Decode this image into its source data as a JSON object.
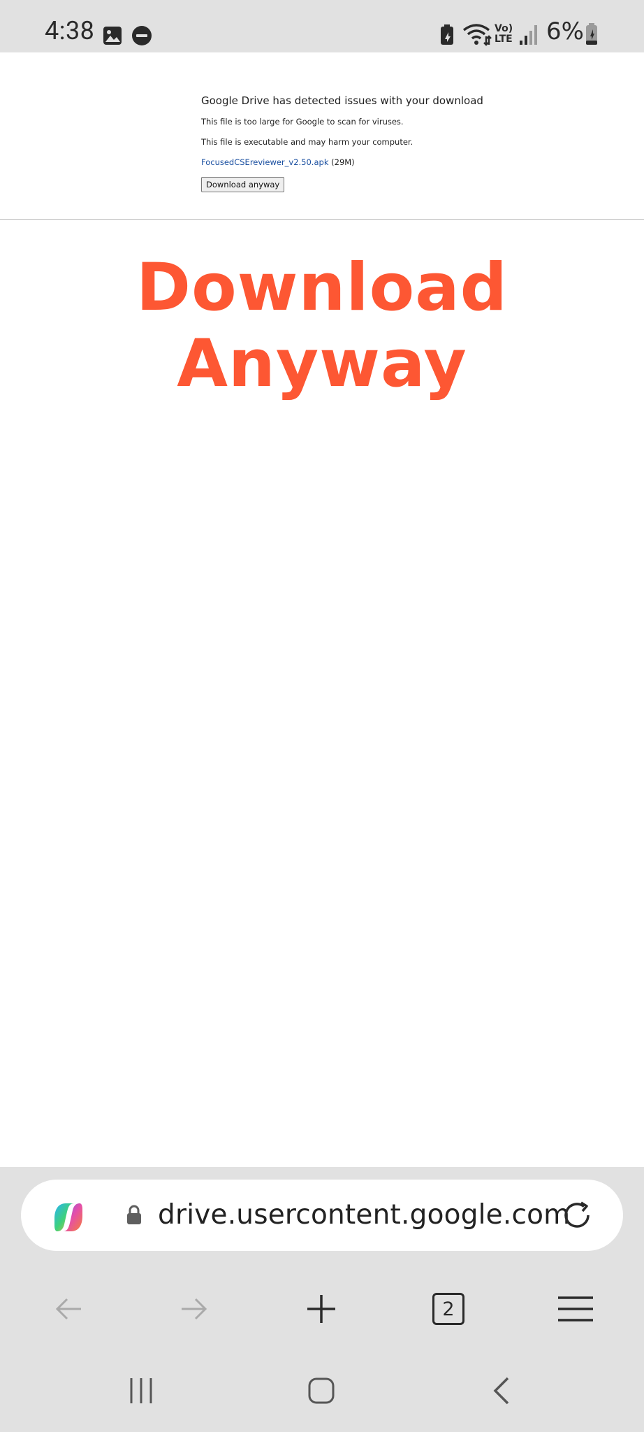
{
  "status_bar": {
    "time": "4:38",
    "battery_percent": "6%",
    "network_label": "Vo) LTE"
  },
  "page": {
    "heading": "Google Drive has detected issues with your download",
    "line1": "This file is too large for Google to scan for viruses.",
    "line2": "This file is executable and may harm your computer.",
    "file_name": "FocusedCSEreviewer_v2.50.apk",
    "file_size": "(29M)",
    "download_button": "Download anyway",
    "banner_text": "Download Anyway"
  },
  "browser": {
    "url": "drive.usercontent.google.com",
    "tab_count": "2"
  },
  "colors": {
    "banner": "#fd5733",
    "link": "#1a4fa0",
    "chrome_bg": "#e1e1e1"
  }
}
